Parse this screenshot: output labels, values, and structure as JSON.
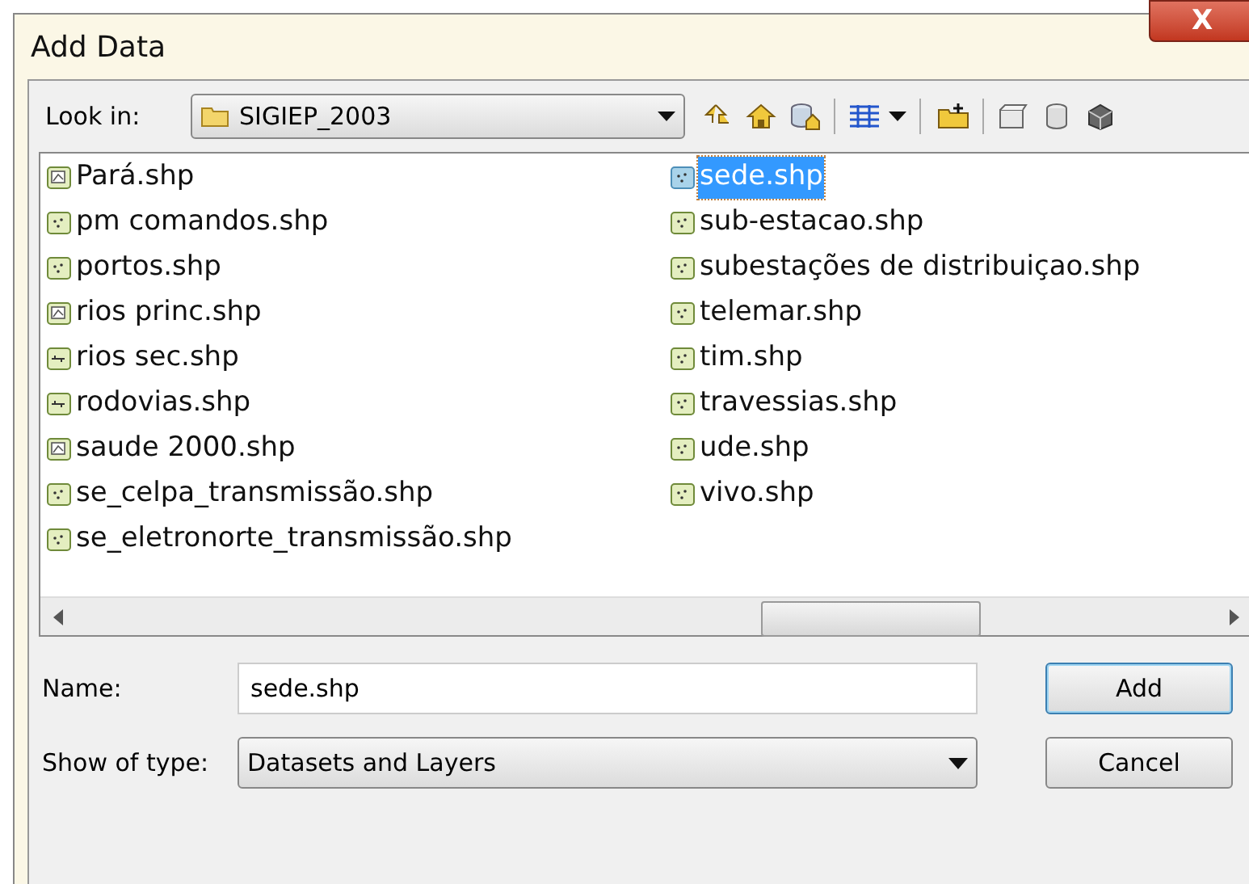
{
  "window": {
    "title": "Add Data",
    "close": "X"
  },
  "look_in": {
    "label": "Look in:",
    "value": "SIGIEP_2003"
  },
  "files": [
    {
      "name": "Pará.shp",
      "kind": "polygon",
      "selected": false
    },
    {
      "name": "pm comandos.shp",
      "kind": "point",
      "selected": false
    },
    {
      "name": "portos.shp",
      "kind": "point",
      "selected": false
    },
    {
      "name": "rios princ.shp",
      "kind": "polygon",
      "selected": false
    },
    {
      "name": "rios sec.shp",
      "kind": "line",
      "selected": false
    },
    {
      "name": "rodovias.shp",
      "kind": "line",
      "selected": false
    },
    {
      "name": "saude 2000.shp",
      "kind": "polygon",
      "selected": false
    },
    {
      "name": "se_celpa_transmissão.shp",
      "kind": "point",
      "selected": false
    },
    {
      "name": "se_eletronorte_transmissão.shp",
      "kind": "point",
      "selected": false
    },
    {
      "name": "sede.shp",
      "kind": "point",
      "selected": true
    },
    {
      "name": "sub-estacao.shp",
      "kind": "point",
      "selected": false
    },
    {
      "name": "subestações de distribuiçao.shp",
      "kind": "point",
      "selected": false
    },
    {
      "name": "telemar.shp",
      "kind": "point",
      "selected": false
    },
    {
      "name": "tim.shp",
      "kind": "point",
      "selected": false
    },
    {
      "name": "travessias.shp",
      "kind": "point",
      "selected": false
    },
    {
      "name": "ude.shp",
      "kind": "point",
      "selected": false
    },
    {
      "name": "vivo.shp",
      "kind": "point",
      "selected": false
    }
  ],
  "name_field": {
    "label": "Name:",
    "value": "sede.shp"
  },
  "type_field": {
    "label": "Show of type:",
    "value": "Datasets and Layers"
  },
  "buttons": [
    "Add",
    "Cancel"
  ]
}
